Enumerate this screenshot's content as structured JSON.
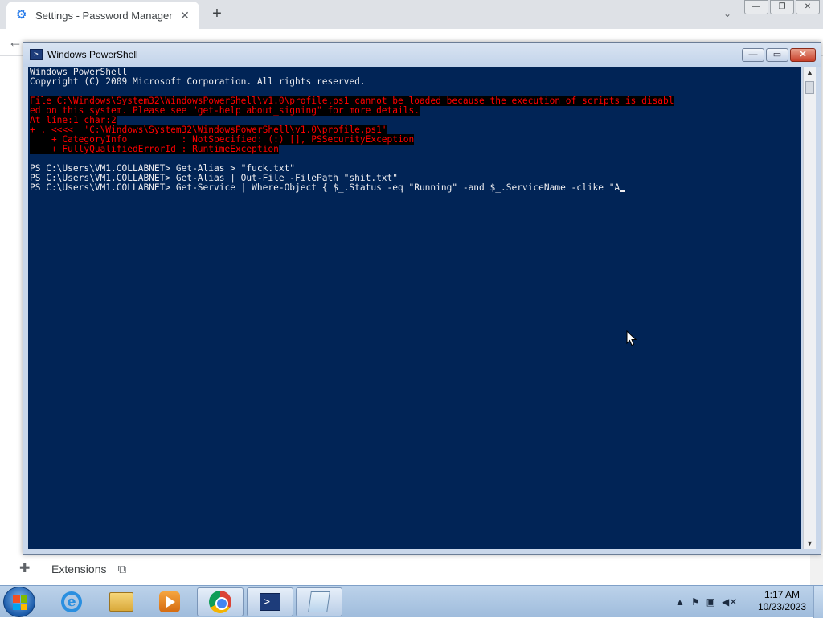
{
  "chrome": {
    "tab_title": "Settings - Password Manager",
    "tab_close": "✕",
    "new_tab": "+",
    "tab_search": "⌄",
    "win_minimize": "—",
    "win_restore": "❐",
    "win_close": "✕",
    "back": "←",
    "extensions_label": "Extensions",
    "open_icon": "⧉"
  },
  "powershell": {
    "title": "Windows PowerShell",
    "btn_minimize": "—",
    "btn_maximize": "▭",
    "btn_close": "✕",
    "lines": [
      {
        "text": "Windows PowerShell",
        "type": "normal"
      },
      {
        "text": "Copyright (C) 2009 Microsoft Corporation. All rights reserved.",
        "type": "normal"
      },
      {
        "text": "",
        "type": "normal"
      },
      {
        "text": "File C:\\Windows\\System32\\WindowsPowerShell\\v1.0\\profile.ps1 cannot be loaded because the execution of scripts is disabl",
        "type": "error"
      },
      {
        "text": "ed on this system. Please see \"get-help about_signing\" for more details.",
        "type": "error"
      },
      {
        "text": "At line:1 char:2",
        "type": "error"
      },
      {
        "text": "+ . <<<<  'C:\\Windows\\System32\\WindowsPowerShell\\v1.0\\profile.ps1'",
        "type": "error"
      },
      {
        "text": "    + CategoryInfo          : NotSpecified: (:) [], PSSecurityException",
        "type": "error"
      },
      {
        "text": "    + FullyQualifiedErrorId : RuntimeException",
        "type": "error"
      },
      {
        "text": "",
        "type": "normal"
      },
      {
        "text": "PS C:\\Users\\VM1.COLLABNET> Get-Alias > \"fuck.txt\"",
        "type": "normal"
      },
      {
        "text": "PS C:\\Users\\VM1.COLLABNET> Get-Alias | Out-File -FilePath \"shit.txt\"",
        "type": "normal"
      },
      {
        "text": "PS C:\\Users\\VM1.COLLABNET> Get-Service | Where-Object { $_.Status -eq \"Running\" -and $_.ServiceName -clike \"A",
        "type": "input"
      }
    ]
  },
  "taskbar": {
    "items": [
      {
        "name": "internet-explorer",
        "active": false
      },
      {
        "name": "windows-explorer",
        "active": false
      },
      {
        "name": "media-player",
        "active": false
      },
      {
        "name": "google-chrome",
        "active": true
      },
      {
        "name": "powershell",
        "active": true
      },
      {
        "name": "notepad",
        "active": true
      }
    ],
    "tray_arrow": "▲",
    "time": "1:17 AM",
    "date": "10/23/2023"
  }
}
